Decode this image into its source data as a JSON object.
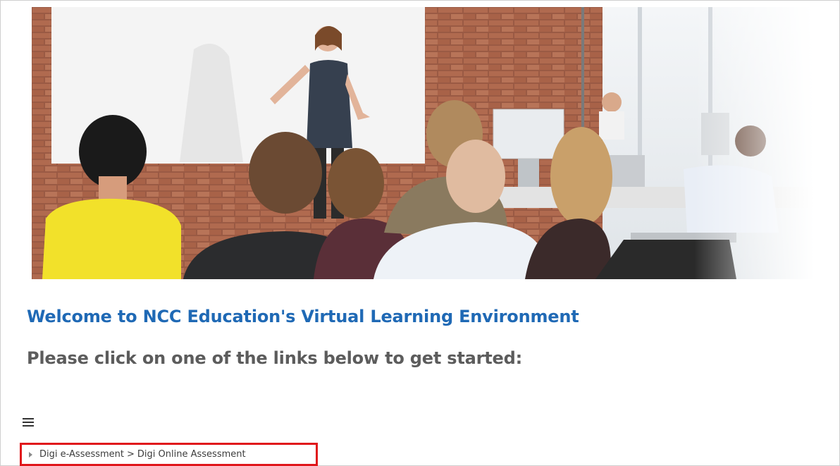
{
  "hero": {
    "icon": "classroom-photo"
  },
  "welcome": {
    "title": "Welcome to NCC Education's Virtual Learning Environment",
    "subtitle": "Please click on one of the links below to get started:"
  },
  "nav": {
    "menu_icon": "hamburger-icon",
    "breadcrumb": {
      "items": [
        "Digi e-Assessment",
        "Digi Online Assessment"
      ],
      "separator": ">"
    }
  },
  "colors": {
    "title": "#1f69b5",
    "subtitle": "#5c5c5c",
    "highlight_border": "#e0161b"
  }
}
